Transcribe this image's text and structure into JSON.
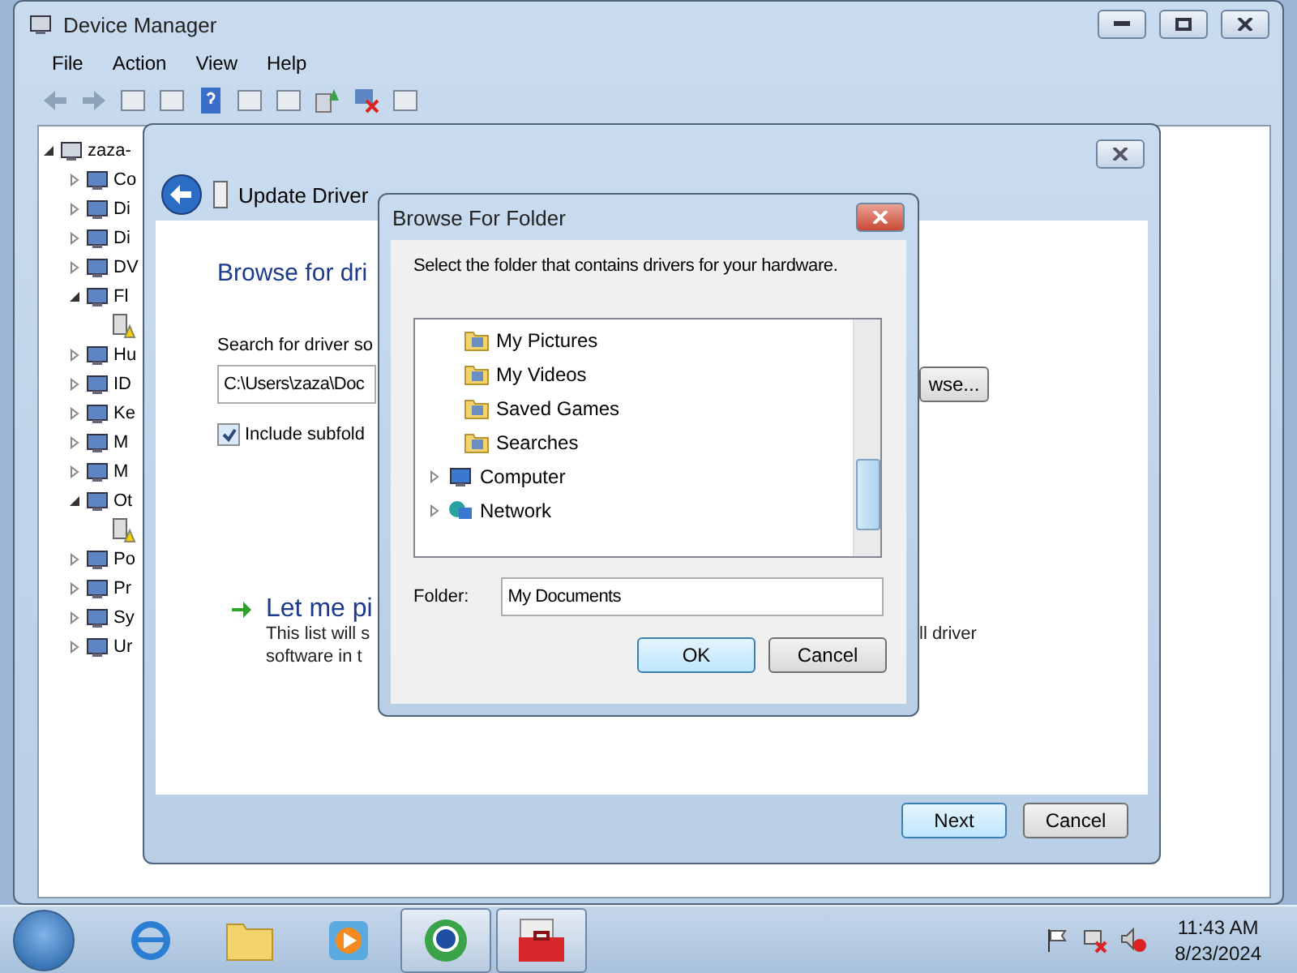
{
  "device_manager": {
    "title": "Device Manager",
    "menu": [
      "File",
      "Action",
      "View",
      "Help"
    ],
    "tree": {
      "label": "zaza-",
      "expanded": true,
      "children": [
        {
          "kind": "device",
          "label": "Co",
          "expanded": false
        },
        {
          "kind": "device",
          "label": "Di",
          "expanded": false
        },
        {
          "kind": "device",
          "label": "Di",
          "expanded": false
        },
        {
          "kind": "device",
          "label": "DV",
          "expanded": false
        },
        {
          "kind": "device",
          "label": "Fl",
          "expanded": true,
          "children": [
            {
              "kind": "unknown"
            }
          ]
        },
        {
          "kind": "device",
          "label": "Hu",
          "expanded": false
        },
        {
          "kind": "device",
          "label": "ID",
          "expanded": false
        },
        {
          "kind": "device",
          "label": "Ke",
          "expanded": false
        },
        {
          "kind": "device",
          "label": "M",
          "expanded": false
        },
        {
          "kind": "device",
          "label": "M",
          "expanded": false
        },
        {
          "kind": "device",
          "label": "Ot",
          "expanded": true,
          "children": [
            {
              "kind": "unknown"
            }
          ]
        },
        {
          "kind": "device",
          "label": "Po",
          "expanded": false
        },
        {
          "kind": "device",
          "label": "Pr",
          "expanded": false
        },
        {
          "kind": "device",
          "label": "Sy",
          "expanded": false
        },
        {
          "kind": "device",
          "label": "Ur",
          "expanded": false
        }
      ]
    }
  },
  "wizard": {
    "title": "Update Driver",
    "heading": "Browse for dri",
    "search_label": "Search for driver so",
    "path_value": "C:\\Users\\zaza\\Doc",
    "browse_button": "wse...",
    "include_subfolders": {
      "label": "Include subfold",
      "checked": true
    },
    "manual_option": {
      "title": "Let me pi",
      "description_left": [
        "This list will s",
        "software in t"
      ],
      "description_right": "ll driver"
    },
    "buttons": [
      {
        "label": "Next",
        "default": true
      },
      {
        "label": "Cancel",
        "default": false
      }
    ]
  },
  "browse_dialog": {
    "title": "Browse For Folder",
    "prompt": "Select the folder that contains drivers for your hardware.",
    "nested_items": [
      "My Pictures",
      "My Videos",
      "Saved Games",
      "Searches"
    ],
    "items": [
      {
        "label": "Computer",
        "expanded": false
      },
      {
        "label": "Network",
        "expanded": false
      }
    ],
    "folder_label": "Folder:",
    "folder_value": "My Documents",
    "buttons": [
      {
        "label": "OK",
        "default": true
      },
      {
        "label": "Cancel",
        "default": false
      }
    ]
  },
  "taskbar": {
    "items": [
      {
        "kind": "browser",
        "selected": false
      },
      {
        "kind": "folder",
        "selected": false
      },
      {
        "kind": "media",
        "selected": false
      },
      {
        "kind": "globe",
        "selected": true
      },
      {
        "kind": "toolbox",
        "selected": true
      }
    ],
    "clock": {
      "time": "11:43 AM",
      "date": "8/23/2024"
    }
  }
}
